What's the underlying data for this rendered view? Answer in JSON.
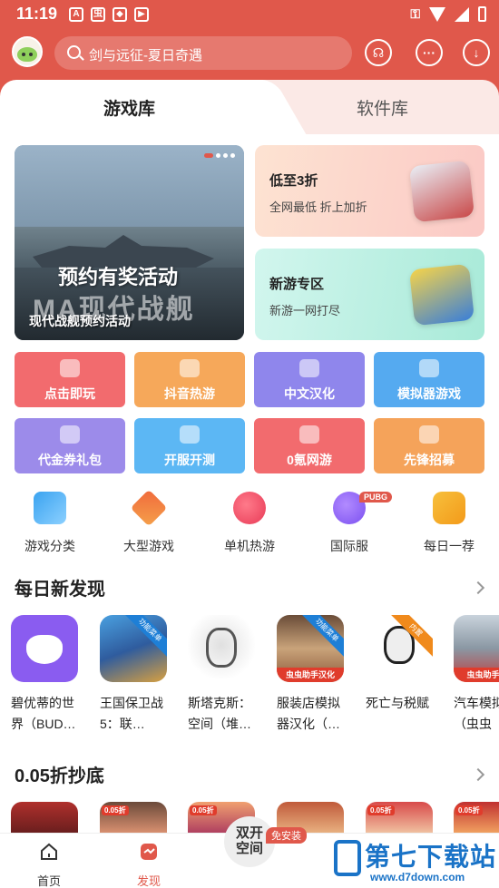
{
  "status_bar": {
    "time": "11:19"
  },
  "header": {
    "search_placeholder": "剑与远征-夏日奇遇",
    "icons": [
      "avatar",
      "search-icon",
      "customer-service-icon",
      "chat-icon",
      "download-icon"
    ]
  },
  "tabs": [
    {
      "label": "游戏库",
      "active": true
    },
    {
      "label": "软件库",
      "active": false
    }
  ],
  "banner": {
    "promo_text": "预约有奖活动",
    "game_title": "现代战舰",
    "caption": "现代战舰预约活动"
  },
  "promo_cards": [
    {
      "title": "低至3折",
      "subtitle": "全网最低 折上加折"
    },
    {
      "title": "新游专区",
      "subtitle": "新游一网打尽"
    }
  ],
  "grid_buttons": [
    {
      "label": "点击即玩",
      "color": "#f26b6e"
    },
    {
      "label": "抖音热游",
      "color": "#f6a85a"
    },
    {
      "label": "中文汉化",
      "color": "#8f86ec"
    },
    {
      "label": "模拟器游戏",
      "color": "#55aaf0"
    },
    {
      "label": "代金券礼包",
      "color": "#9c8bea"
    },
    {
      "label": "开服开测",
      "color": "#5cb7f4"
    },
    {
      "label": "0氪网游",
      "color": "#f26b6e"
    },
    {
      "label": "先锋招募",
      "color": "#f5a35a"
    }
  ],
  "categories": [
    {
      "label": "游戏分类"
    },
    {
      "label": "大型游戏"
    },
    {
      "label": "单机热游"
    },
    {
      "label": "国际服",
      "badge": "PUBG"
    },
    {
      "label": "每日一荐"
    }
  ],
  "daily": {
    "title": "每日新发现",
    "games": [
      {
        "name": "碧优蒂的世界（BUD…"
      },
      {
        "name": "王国保卫战5：联…",
        "ribbon": "功能菜单"
      },
      {
        "name": "斯塔克斯：空间（堆…"
      },
      {
        "name": "服装店模拟器汉化（…",
        "ribbon": "功能菜单",
        "tag": "虫虫助手汉化"
      },
      {
        "name": "死亡与税赋",
        "ribbon": "内置"
      },
      {
        "name": "汽车模拟化（虫虫",
        "tag": "虫虫助手汉"
      }
    ]
  },
  "discount": {
    "title": "0.05折抄底",
    "thumb_badges": [
      "",
      "0.05折",
      "0.05折",
      "",
      "0.05折",
      "0.05折"
    ]
  },
  "bottom_nav": {
    "home": "首页",
    "discover": "发现",
    "dual_space": "双开空间",
    "free_install": "免安装",
    "watermark_title": "第七下载站",
    "watermark_url": "www.d7down.com"
  },
  "colors": {
    "brand": "#e0584b",
    "watermark": "#1a73c7"
  }
}
